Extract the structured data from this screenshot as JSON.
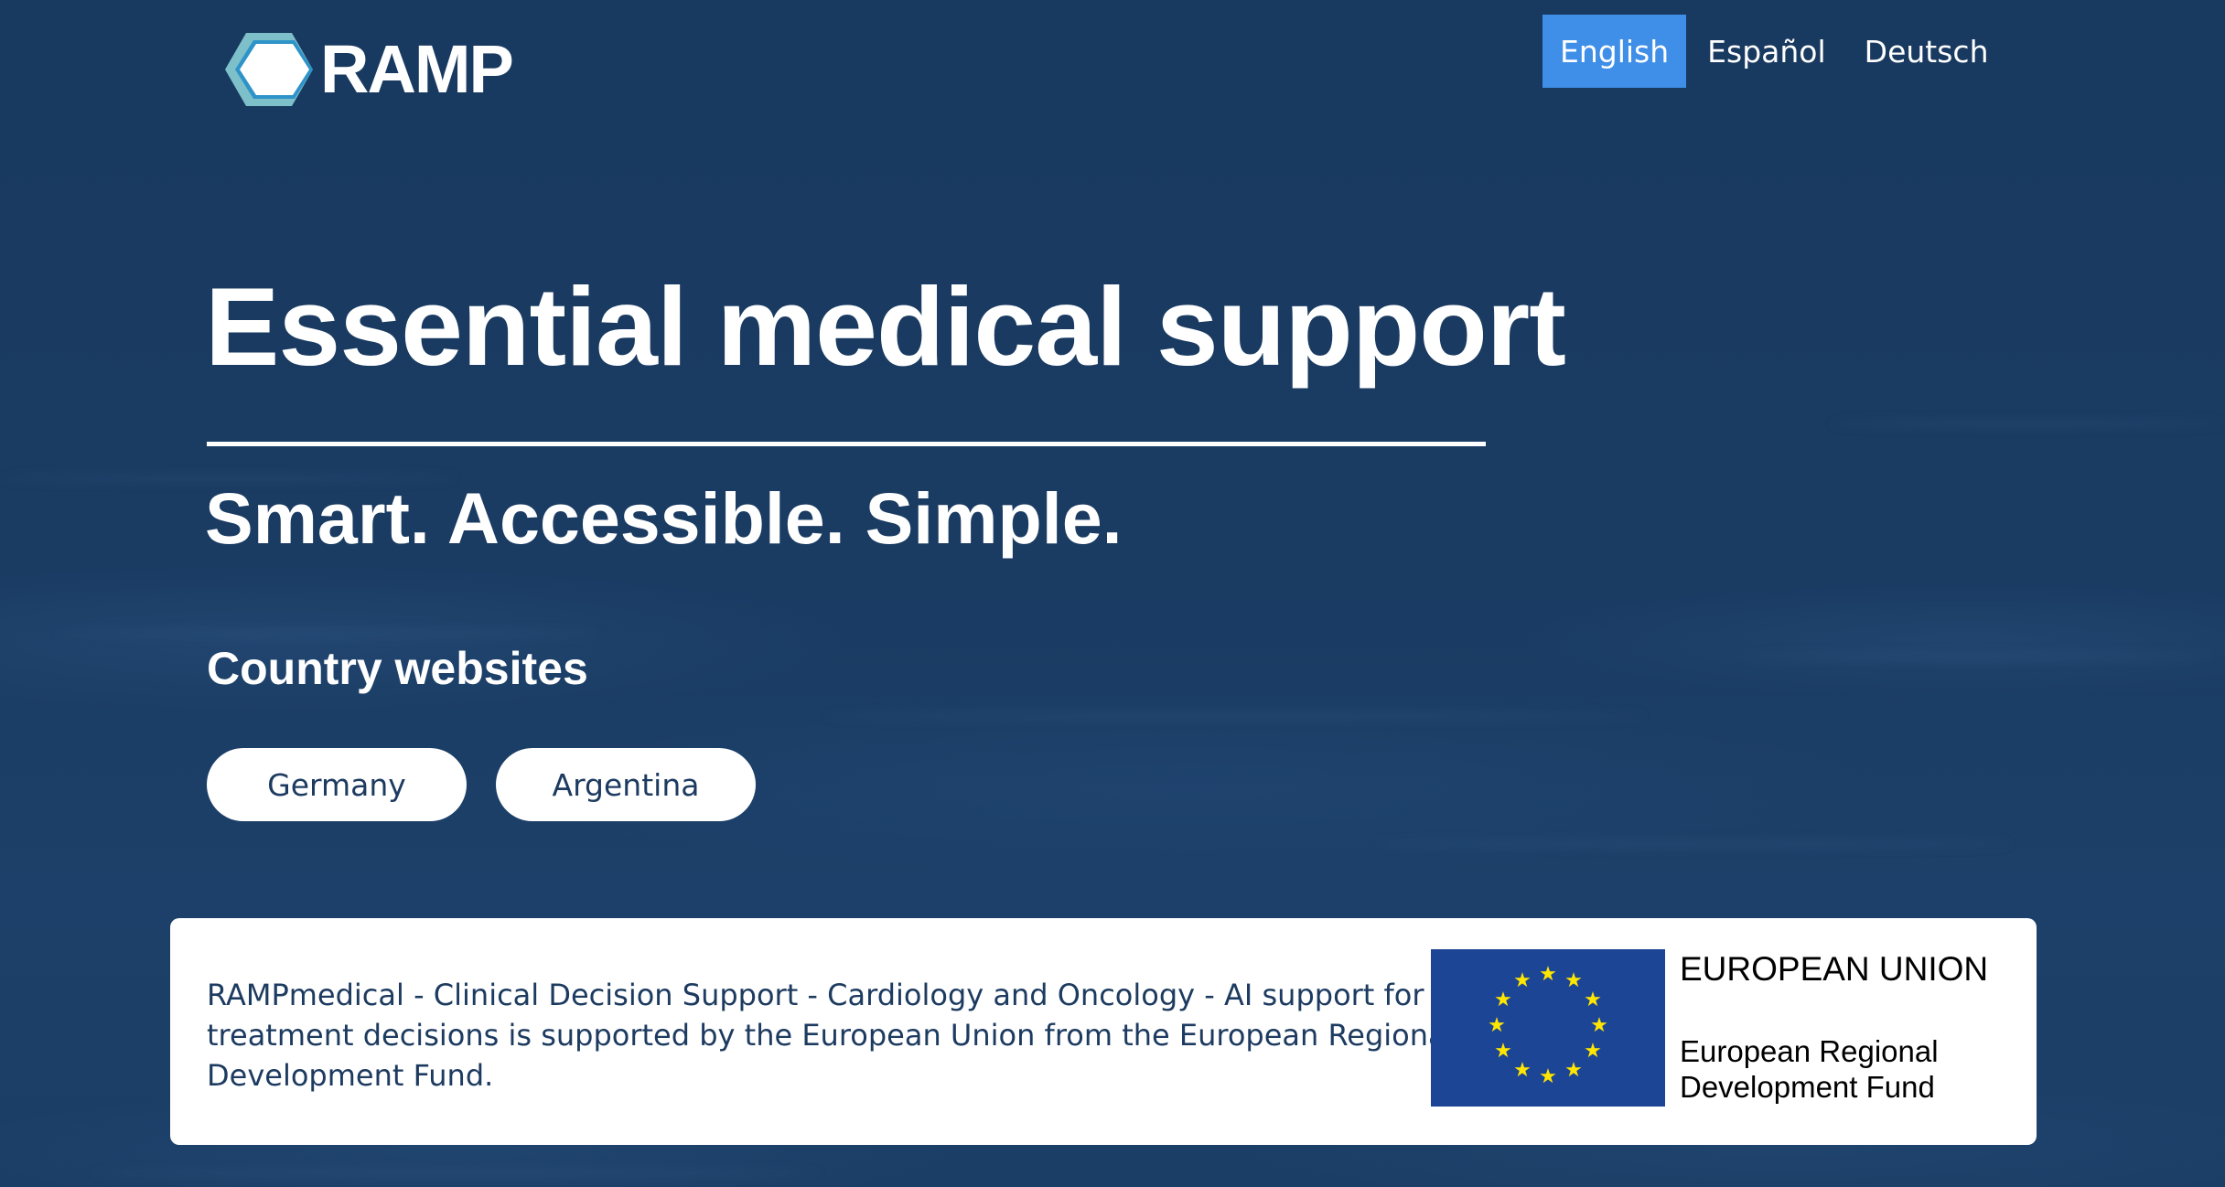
{
  "header": {
    "logo_text": "RAMP",
    "logo_icon": "hexagon-logo-icon",
    "languages": [
      {
        "label": "English",
        "active": true
      },
      {
        "label": "Español",
        "active": false
      },
      {
        "label": "Deutsch",
        "active": false
      }
    ]
  },
  "hero": {
    "title": "Essential medical support",
    "subtitle": "Smart. Accessible. Simple."
  },
  "country": {
    "heading": "Country websites",
    "buttons": [
      "Germany",
      "Argentina"
    ]
  },
  "eu_notice": {
    "text": "RAMPmedical - Clinical Decision Support - Cardiology and Oncology - AI support for safe treatment decisions is supported by the European Union from the European Regional Development Fund.",
    "label_main": "EUROPEAN UNION",
    "label_fund": "European Regional Development Fund",
    "flag_icon": "eu-flag-icon"
  },
  "colors": {
    "background": "#1a3a61",
    "active_language": "#3f8fe8",
    "button_text": "#1d3b60",
    "eu_flag_blue": "#1d4596",
    "eu_star_yellow": "#ffe600",
    "logo_outer": "#7ec0c9",
    "logo_inner": "#2e93c9"
  }
}
